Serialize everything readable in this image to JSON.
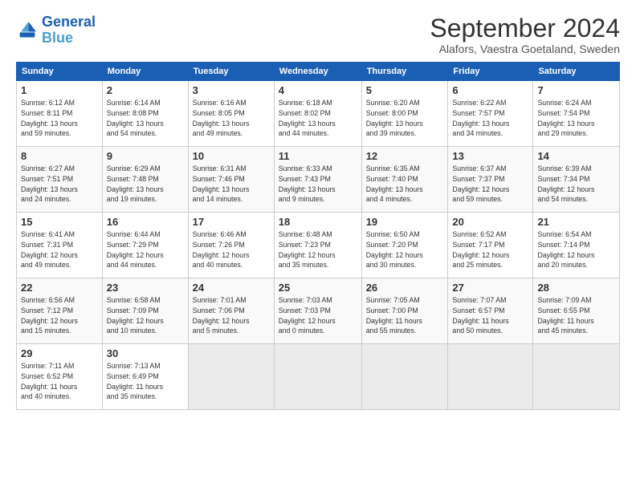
{
  "header": {
    "logo_line1": "General",
    "logo_line2": "Blue",
    "month": "September 2024",
    "location": "Alafors, Vaestra Goetaland, Sweden"
  },
  "days_of_week": [
    "Sunday",
    "Monday",
    "Tuesday",
    "Wednesday",
    "Thursday",
    "Friday",
    "Saturday"
  ],
  "weeks": [
    [
      {
        "day": 1,
        "info": "Sunrise: 6:12 AM\nSunset: 8:11 PM\nDaylight: 13 hours\nand 59 minutes."
      },
      {
        "day": 2,
        "info": "Sunrise: 6:14 AM\nSunset: 8:08 PM\nDaylight: 13 hours\nand 54 minutes."
      },
      {
        "day": 3,
        "info": "Sunrise: 6:16 AM\nSunset: 8:05 PM\nDaylight: 13 hours\nand 49 minutes."
      },
      {
        "day": 4,
        "info": "Sunrise: 6:18 AM\nSunset: 8:02 PM\nDaylight: 13 hours\nand 44 minutes."
      },
      {
        "day": 5,
        "info": "Sunrise: 6:20 AM\nSunset: 8:00 PM\nDaylight: 13 hours\nand 39 minutes."
      },
      {
        "day": 6,
        "info": "Sunrise: 6:22 AM\nSunset: 7:57 PM\nDaylight: 13 hours\nand 34 minutes."
      },
      {
        "day": 7,
        "info": "Sunrise: 6:24 AM\nSunset: 7:54 PM\nDaylight: 13 hours\nand 29 minutes."
      }
    ],
    [
      {
        "day": 8,
        "info": "Sunrise: 6:27 AM\nSunset: 7:51 PM\nDaylight: 13 hours\nand 24 minutes."
      },
      {
        "day": 9,
        "info": "Sunrise: 6:29 AM\nSunset: 7:48 PM\nDaylight: 13 hours\nand 19 minutes."
      },
      {
        "day": 10,
        "info": "Sunrise: 6:31 AM\nSunset: 7:46 PM\nDaylight: 13 hours\nand 14 minutes."
      },
      {
        "day": 11,
        "info": "Sunrise: 6:33 AM\nSunset: 7:43 PM\nDaylight: 13 hours\nand 9 minutes."
      },
      {
        "day": 12,
        "info": "Sunrise: 6:35 AM\nSunset: 7:40 PM\nDaylight: 13 hours\nand 4 minutes."
      },
      {
        "day": 13,
        "info": "Sunrise: 6:37 AM\nSunset: 7:37 PM\nDaylight: 12 hours\nand 59 minutes."
      },
      {
        "day": 14,
        "info": "Sunrise: 6:39 AM\nSunset: 7:34 PM\nDaylight: 12 hours\nand 54 minutes."
      }
    ],
    [
      {
        "day": 15,
        "info": "Sunrise: 6:41 AM\nSunset: 7:31 PM\nDaylight: 12 hours\nand 49 minutes."
      },
      {
        "day": 16,
        "info": "Sunrise: 6:44 AM\nSunset: 7:29 PM\nDaylight: 12 hours\nand 44 minutes."
      },
      {
        "day": 17,
        "info": "Sunrise: 6:46 AM\nSunset: 7:26 PM\nDaylight: 12 hours\nand 40 minutes."
      },
      {
        "day": 18,
        "info": "Sunrise: 6:48 AM\nSunset: 7:23 PM\nDaylight: 12 hours\nand 35 minutes."
      },
      {
        "day": 19,
        "info": "Sunrise: 6:50 AM\nSunset: 7:20 PM\nDaylight: 12 hours\nand 30 minutes."
      },
      {
        "day": 20,
        "info": "Sunrise: 6:52 AM\nSunset: 7:17 PM\nDaylight: 12 hours\nand 25 minutes."
      },
      {
        "day": 21,
        "info": "Sunrise: 6:54 AM\nSunset: 7:14 PM\nDaylight: 12 hours\nand 20 minutes."
      }
    ],
    [
      {
        "day": 22,
        "info": "Sunrise: 6:56 AM\nSunset: 7:12 PM\nDaylight: 12 hours\nand 15 minutes."
      },
      {
        "day": 23,
        "info": "Sunrise: 6:58 AM\nSunset: 7:09 PM\nDaylight: 12 hours\nand 10 minutes."
      },
      {
        "day": 24,
        "info": "Sunrise: 7:01 AM\nSunset: 7:06 PM\nDaylight: 12 hours\nand 5 minutes."
      },
      {
        "day": 25,
        "info": "Sunrise: 7:03 AM\nSunset: 7:03 PM\nDaylight: 12 hours\nand 0 minutes."
      },
      {
        "day": 26,
        "info": "Sunrise: 7:05 AM\nSunset: 7:00 PM\nDaylight: 11 hours\nand 55 minutes."
      },
      {
        "day": 27,
        "info": "Sunrise: 7:07 AM\nSunset: 6:57 PM\nDaylight: 11 hours\nand 50 minutes."
      },
      {
        "day": 28,
        "info": "Sunrise: 7:09 AM\nSunset: 6:55 PM\nDaylight: 11 hours\nand 45 minutes."
      }
    ],
    [
      {
        "day": 29,
        "info": "Sunrise: 7:11 AM\nSunset: 6:52 PM\nDaylight: 11 hours\nand 40 minutes."
      },
      {
        "day": 30,
        "info": "Sunrise: 7:13 AM\nSunset: 6:49 PM\nDaylight: 11 hours\nand 35 minutes."
      },
      null,
      null,
      null,
      null,
      null
    ]
  ]
}
